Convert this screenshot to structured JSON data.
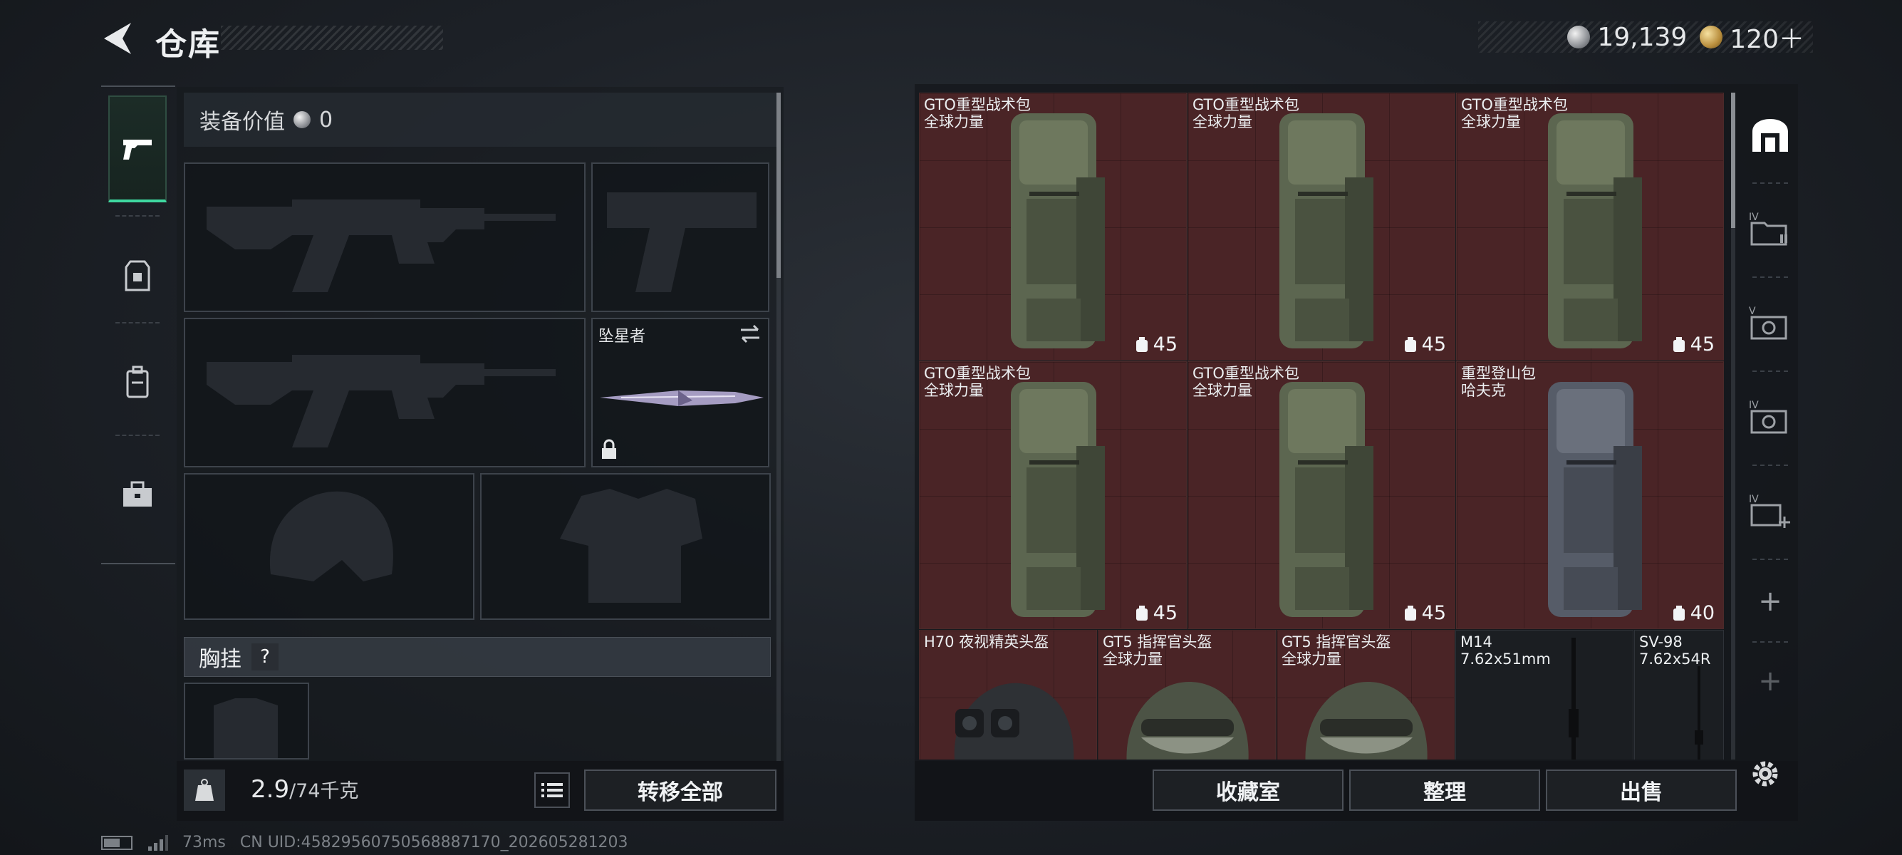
{
  "header": {
    "title": "仓库",
    "currencies": [
      {
        "icon": "silver-coin-icon",
        "value": "19,139"
      },
      {
        "icon": "gold-coin-icon",
        "value": "120＋"
      }
    ]
  },
  "equipment": {
    "value_label": "装备价值",
    "value": "0",
    "melee_name": "坠星者",
    "chest_rig_label": "胸挂",
    "help": "?",
    "weight_current": "2.9",
    "weight_max": "/74千克",
    "transfer_all": "转移全部"
  },
  "stash": {
    "items": [
      {
        "name": "GTO重型战术包",
        "sub": "全球力量",
        "count": "45"
      },
      {
        "name": "GTO重型战术包",
        "sub": "全球力量",
        "count": "45"
      },
      {
        "name": "GTO重型战术包",
        "sub": "全球力量",
        "count": "45"
      },
      {
        "name": "GTO重型战术包",
        "sub": "全球力量",
        "count": "45"
      },
      {
        "name": "GTO重型战术包",
        "sub": "全球力量",
        "count": "45"
      },
      {
        "name": "重型登山包",
        "sub": "哈夫克",
        "count": "40"
      }
    ],
    "small_items": [
      {
        "name": "H70 夜视精英头盔",
        "sub": ""
      },
      {
        "name": "GT5 指挥官头盔",
        "sub": "全球力量"
      },
      {
        "name": "GT5 指挥官头盔",
        "sub": "全球力量"
      },
      {
        "name": "M14",
        "sub": "7.62x51mm"
      },
      {
        "name": "SV-98",
        "sub": "7.62x54R"
      }
    ]
  },
  "actions": {
    "collection": "收藏室",
    "organize": "整理",
    "sell": "出售"
  },
  "status": {
    "ping": "73ms",
    "uid": "CN UID:4582956075056888717​0_202605281203"
  },
  "colors": {
    "accent": "#3fd8a0",
    "tile_bg": "#4a2426"
  }
}
